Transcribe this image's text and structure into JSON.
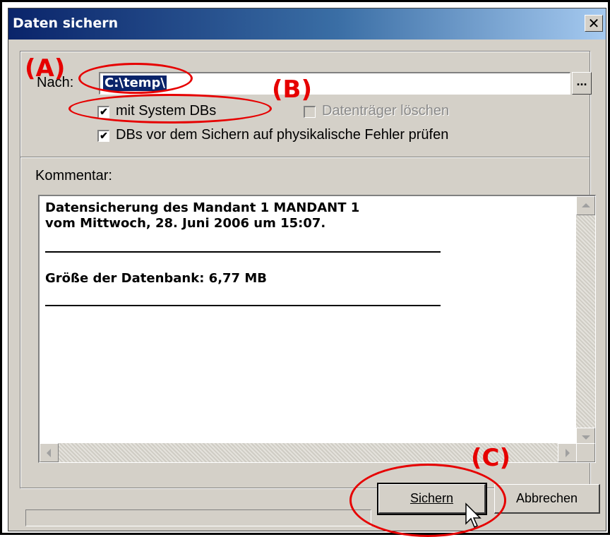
{
  "window": {
    "title": "Daten sichern",
    "close_glyph": "✕"
  },
  "path": {
    "label": "Nach:",
    "value": "C:\\temp\\",
    "browse_label": "..."
  },
  "options": {
    "system_dbs": {
      "label": "mit System DBs",
      "checked": true
    },
    "erase_media": {
      "label": "Datenträger löschen",
      "checked": false,
      "enabled": false
    },
    "check_errors": {
      "label": "DBs vor dem Sichern auf physikalische Fehler prüfen",
      "checked": true
    }
  },
  "comment": {
    "label": "Kommentar:",
    "lines": [
      "Datensicherung des Mandant 1 MANDANT 1",
      "vom Mittwoch, 28. Juni 2006 um 15:07.",
      "Größe der Datenbank: 6,77 MB"
    ]
  },
  "buttons": {
    "save": "Sichern",
    "cancel": "Abbrechen"
  },
  "annotations": {
    "a": "(A)",
    "b": "(B)",
    "c": "(C)",
    "color": "#e60000"
  },
  "colors": {
    "titlebar_start": "#0a246a",
    "titlebar_end": "#a6caf0",
    "face": "#d4d0c8"
  }
}
